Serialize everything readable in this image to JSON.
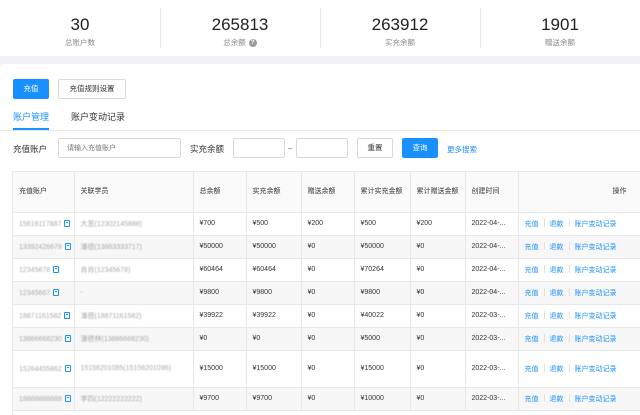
{
  "stats": [
    {
      "value": "30",
      "label": "总账户数"
    },
    {
      "value": "265813",
      "label": "总余额",
      "help_icon": "question-circle-icon"
    },
    {
      "value": "263912",
      "label": "实充余额"
    },
    {
      "value": "1901",
      "label": "赠送余额"
    }
  ],
  "toolbar": {
    "recharge_label": "充值",
    "rules_label": "充值规则设置"
  },
  "tabs": [
    {
      "label": "账户管理",
      "active": true
    },
    {
      "label": "账户变动记录",
      "active": false
    }
  ],
  "filters": {
    "account_label": "充值账户",
    "account_placeholder": "请输入充值账户",
    "balance_label": "实充余额",
    "range_sep": "–",
    "reset_label": "重置",
    "search_label": "查询",
    "more_label": "更多搜索"
  },
  "table": {
    "headers": [
      "充值账户",
      "关联学员",
      "总余额",
      "实充余额",
      "赠送余额",
      "累计实充金额",
      "累计赠送金额",
      "创建时间",
      "操作"
    ],
    "actions": [
      "充值",
      "退款",
      "账户变动记录"
    ],
    "rows": [
      {
        "account": "15616117887",
        "student": "大葱(12302145888)",
        "total": "¥700",
        "real": "¥500",
        "gift": "¥200",
        "cum_real": "¥500",
        "cum_gift": "¥200",
        "created": "2022-04-..."
      },
      {
        "account": "13392426678",
        "student": "潘德(13863333717)",
        "total": "¥50000",
        "real": "¥50000",
        "gift": "¥0",
        "cum_real": "¥50000",
        "cum_gift": "¥0",
        "created": "2022-04-..."
      },
      {
        "account": "12345678",
        "student": "肖肖(12345678)",
        "total": "¥60464",
        "real": "¥60464",
        "gift": "¥0",
        "cum_real": "¥70264",
        "cum_gift": "¥0",
        "created": "2022-04-..."
      },
      {
        "account": "12345667",
        "student": "-",
        "total": "¥9800",
        "real": "¥9800",
        "gift": "¥0",
        "cum_real": "¥9800",
        "cum_gift": "¥0",
        "created": "2022-04-..."
      },
      {
        "account": "18871161582",
        "student": "潘德(18871161582)",
        "total": "¥39922",
        "real": "¥39922",
        "gift": "¥0",
        "cum_real": "¥40022",
        "cum_gift": "¥0",
        "created": "2022-03-..."
      },
      {
        "account": "13886668230",
        "student": "潘德林(13886668230)",
        "total": "¥0",
        "real": "¥0",
        "gift": "¥0",
        "cum_real": "¥5000",
        "cum_gift": "¥0",
        "created": "2022-03-..."
      },
      {
        "account": "15264455862",
        "student": "15156201085(15156201096)",
        "total": "¥15000",
        "real": "¥15000",
        "gift": "¥0",
        "cum_real": "¥15000",
        "cum_gift": "¥0",
        "created": "2022-03-...",
        "tall": true
      },
      {
        "account": "18888888888",
        "student": "李四(12222222222)",
        "total": "¥9700",
        "real": "¥9700",
        "gift": "¥0",
        "cum_real": "¥10000",
        "cum_gift": "¥0",
        "created": "2022-03-..."
      }
    ]
  },
  "colors": {
    "accent": "#1890ff",
    "background": "#f0f2f5"
  }
}
